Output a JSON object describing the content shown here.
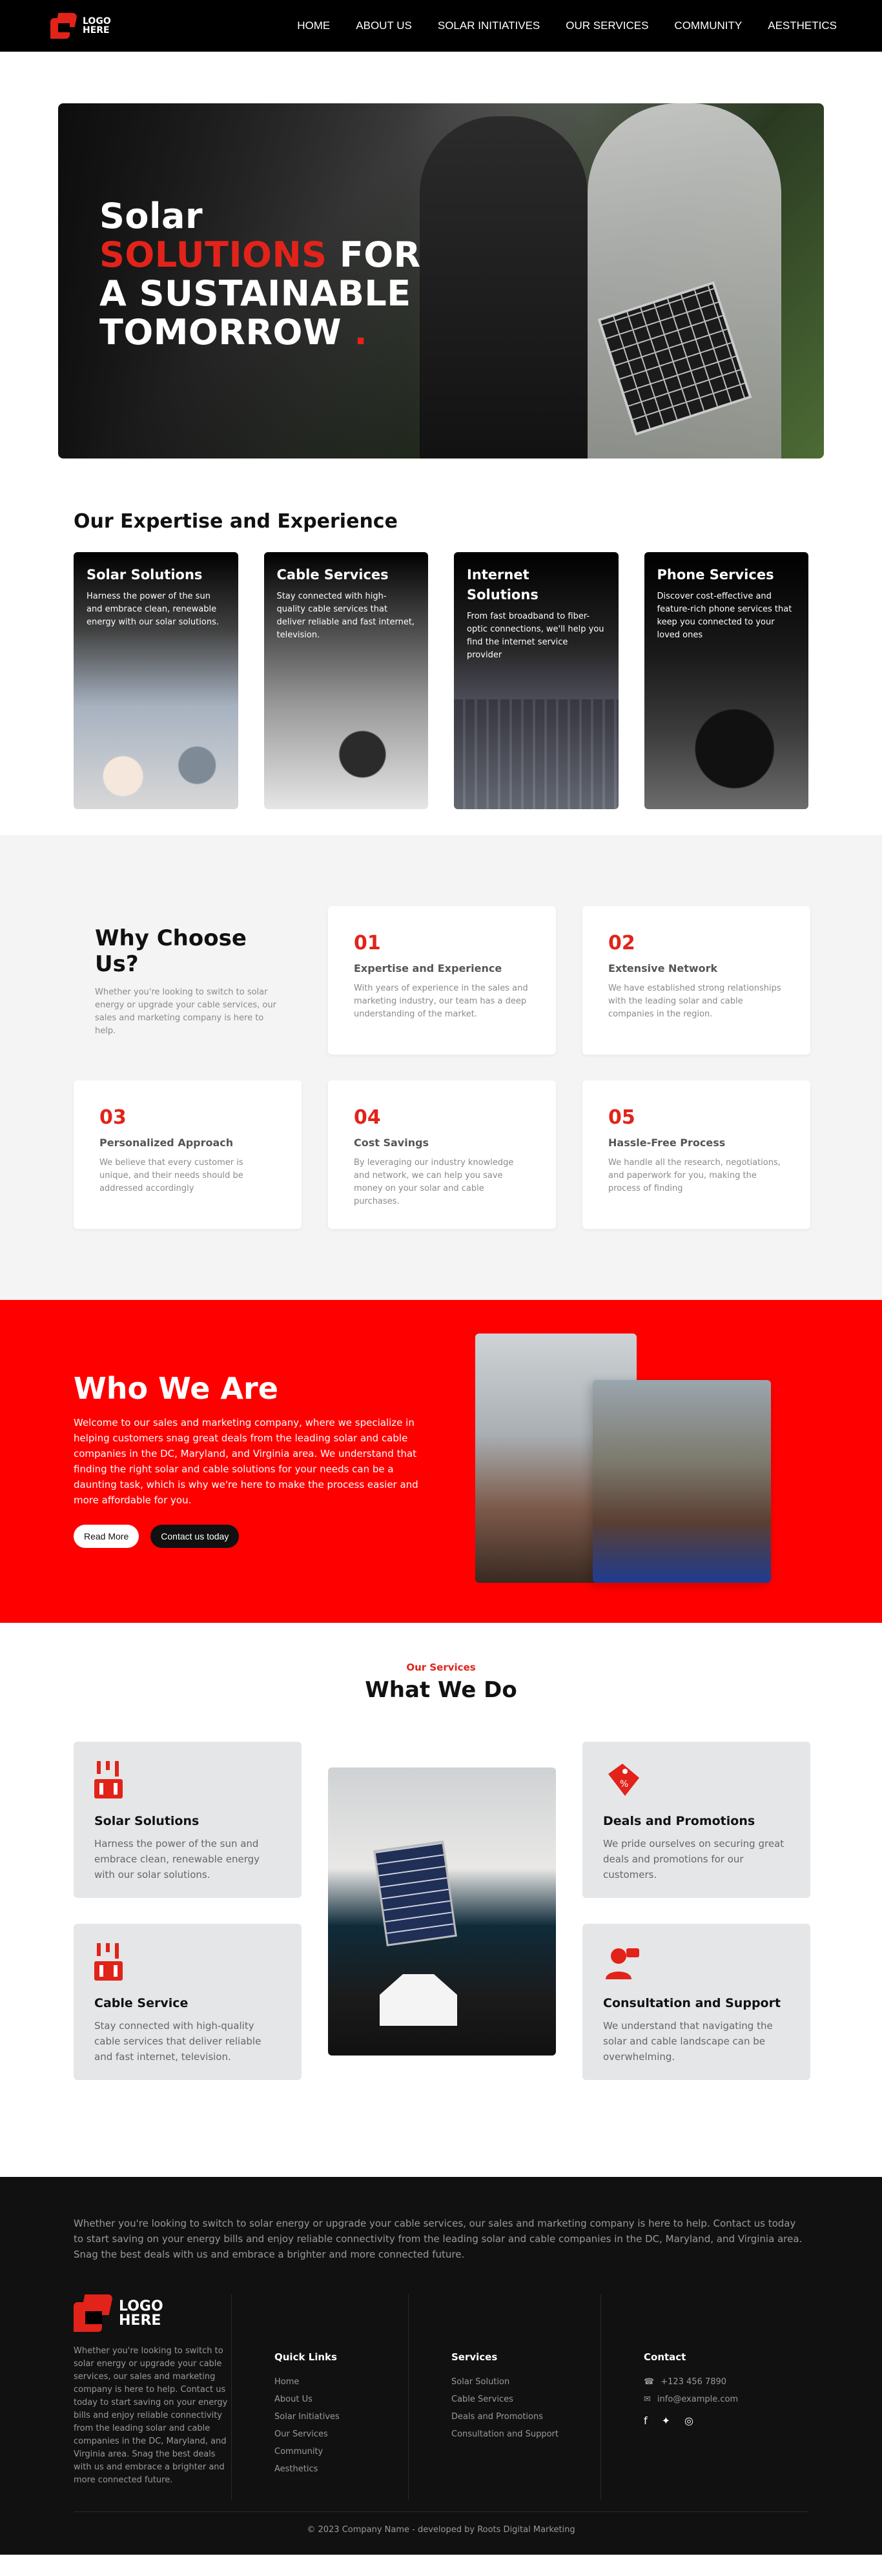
{
  "nav": {
    "logo_line1": "LOGO",
    "logo_line2": "HERE",
    "links": [
      "HOME",
      "ABOUT US",
      "SOLAR INITIATIVES",
      "OUR SERVICES",
      "COMMUNITY",
      "AESTHETICS"
    ]
  },
  "hero": {
    "line1": "Solar",
    "line2_red": "SOLUTIONS",
    "line2_white": " FOR",
    "line3": "A SUSTAINABLE",
    "line4": "TOMORROW ",
    "dot": "."
  },
  "expertise": {
    "title": "Our Expertise and Experience",
    "cards": [
      {
        "title": "Solar Solutions",
        "text": "Harness the power of the sun and embrace clean, renewable energy with our solar solutions."
      },
      {
        "title": "Cable Services",
        "text": "Stay connected with high-quality cable services that deliver reliable and fast internet, television."
      },
      {
        "title": "Internet Solutions",
        "text": "From fast broadband to fiber-optic connections, we'll help you find the internet service provider"
      },
      {
        "title": "Phone Services",
        "text": "Discover cost-effective and feature-rich phone services that keep you connected to your loved ones"
      }
    ]
  },
  "why": {
    "title": "Why Choose Us?",
    "intro": "Whether you're looking to switch to solar energy or upgrade your cable services, our sales and marketing company is here to help.",
    "items": [
      {
        "num": "01",
        "title": "Expertise and Experience",
        "text": "With years of experience in the sales and marketing industry, our team has a deep understanding of the market."
      },
      {
        "num": "02",
        "title": "Extensive Network",
        "text": "We have established strong relationships with the leading solar and cable companies in the region."
      },
      {
        "num": "03",
        "title": "Personalized Approach",
        "text": "We believe that every customer is unique, and their needs should be addressed accordingly"
      },
      {
        "num": "04",
        "title": "Cost Savings",
        "text": "By leveraging our industry knowledge and network, we can help you save money on your solar and cable purchases."
      },
      {
        "num": "05",
        "title": "Hassle-Free Process",
        "text": "We handle all the research, negotiations, and paperwork for you, making the process of finding"
      }
    ]
  },
  "who": {
    "title": "Who We Are",
    "text": "Welcome to our sales and marketing company, where we specialize in helping customers snag great deals from the leading solar and cable companies in the DC, Maryland, and Virginia area. We understand that finding the right solar and cable solutions for your needs can be a daunting task, which is why we're here to make the process easier and more affordable for you.",
    "read_more": "Read More",
    "contact": "Contact us today"
  },
  "services": {
    "kicker": "Our Services",
    "title": "What We Do",
    "items": [
      {
        "title": "Solar Solutions",
        "text": "Harness the power of the sun and embrace clean, renewable energy with our solar solutions."
      },
      {
        "title": "Cable Service",
        "text": "Stay connected with high-quality cable services that deliver reliable and fast internet, television."
      },
      {
        "title": "Deals and Promotions",
        "text": "We pride ourselves on securing great deals and promotions for our customers."
      },
      {
        "title": "Consultation and Support",
        "text": "We understand that navigating the solar and cable landscape can be overwhelming."
      }
    ]
  },
  "footer": {
    "top_text": "Whether you're looking to switch to solar energy or upgrade your cable services, our sales and marketing company is here to help. Contact us today to start saving on your energy bills and enjoy reliable connectivity from the leading solar and cable companies in the DC, Maryland, and Virginia area. Snag the best deals with us and embrace a brighter and more connected future.",
    "logo_line1": "LOGO",
    "logo_line2": "HERE",
    "about": "Whether you're looking to switch to solar energy or upgrade your cable services, our sales and marketing company is here to help. Contact us today to start saving on your energy bills and enjoy reliable connectivity from the leading solar and cable companies in the DC, Maryland, and Virginia area. Snag the best deals with us and embrace a brighter and more connected future.",
    "quick_title": "Quick Links",
    "quick_links": [
      "Home",
      "About Us",
      "Solar Initiatives",
      "Our Services",
      "Community",
      "Aesthetics"
    ],
    "services_title": "Services",
    "service_links": [
      "Solar Solution",
      "Cable Services",
      "Deals and Promotions",
      "Consultation and Support"
    ],
    "contact_title": "Contact",
    "phone": "+123 456 7890",
    "email": "info@example.com",
    "copyright": "© 2023 Company Name - developed by Roots Digital Marketing"
  },
  "colors": {
    "accent": "#e2231a",
    "who_bg": "#ff0000",
    "footer_bg": "#111111"
  }
}
